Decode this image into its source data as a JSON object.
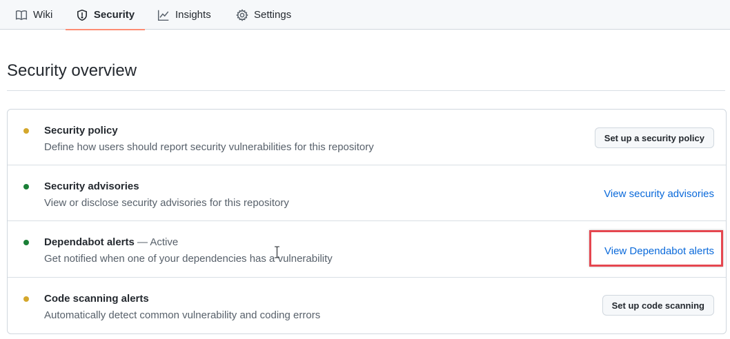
{
  "tabs": [
    {
      "label": "Wiki",
      "icon": "book-icon"
    },
    {
      "label": "Security",
      "icon": "shield-icon",
      "selected": true
    },
    {
      "label": "Insights",
      "icon": "graph-icon"
    },
    {
      "label": "Settings",
      "icon": "gear-icon"
    }
  ],
  "page": {
    "title": "Security overview"
  },
  "rows": [
    {
      "title": "Security policy",
      "status": "",
      "description": "Define how users should report security vulnerabilities for this repository",
      "indicator_color": "#d4a72c",
      "action": {
        "type": "button",
        "label": "Set up a security policy"
      }
    },
    {
      "title": "Security advisories",
      "status": "",
      "description": "View or disclose security advisories for this repository",
      "indicator_color": "#1a7f37",
      "action": {
        "type": "link",
        "label": "View security advisories"
      }
    },
    {
      "title": "Dependabot alerts",
      "status": "— Active",
      "description": "Get notified when one of your dependencies has a vulnerability",
      "indicator_color": "#1a7f37",
      "action": {
        "type": "link",
        "label": "View Dependabot alerts",
        "highlighted": true
      }
    },
    {
      "title": "Code scanning alerts",
      "status": "",
      "description": "Automatically detect common vulnerability and coding errors",
      "indicator_color": "#d4a72c",
      "action": {
        "type": "button",
        "label": "Set up code scanning"
      }
    }
  ],
  "colors": {
    "accent_link": "#0969da",
    "selected_tab_underline": "#fd8c73",
    "highlight_box": "#e5464f"
  }
}
